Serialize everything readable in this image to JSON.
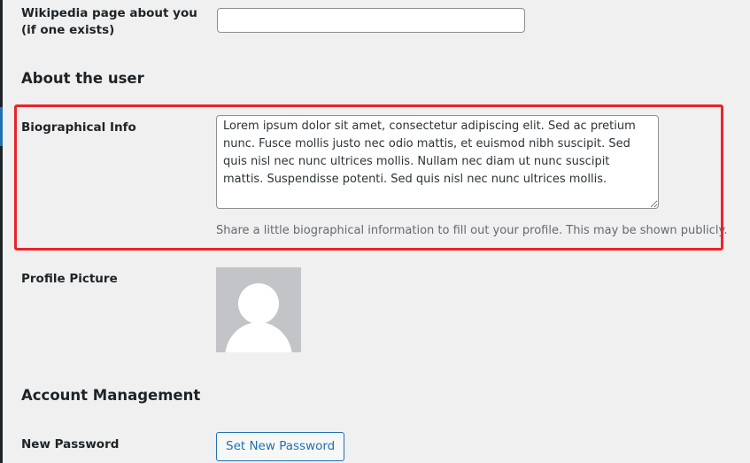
{
  "contact": {
    "wikipedia_label_line1": "Wikipedia page about you",
    "wikipedia_label_line2": "(if one exists)",
    "wikipedia_value": ""
  },
  "about_section": {
    "title": "About the user",
    "bio_label": "Biographical Info",
    "bio_value": "Lorem ipsum dolor sit amet, consectetur adipiscing elit. Sed ac pretium nunc. Fusce mollis justo nec odio mattis, et euismod nibh suscipit. Sed quis nisl nec nunc ultrices mollis. Nullam nec diam ut nunc suscipit mattis. Suspendisse potenti. Sed quis nisl nec nunc ultrices mollis.",
    "bio_description": "Share a little biographical information to fill out your profile. This may be shown publicly.",
    "profile_picture_label": "Profile Picture",
    "avatar_icon": "default-avatar-icon"
  },
  "account_section": {
    "title": "Account Management",
    "new_password_label": "New Password",
    "set_password_button": "Set New Password"
  },
  "colors": {
    "background": "#f0f0f1",
    "accent": "#2271b1",
    "highlight": "#e8252a",
    "muted_text": "#646970",
    "avatar_bg": "#c3c4c7"
  }
}
